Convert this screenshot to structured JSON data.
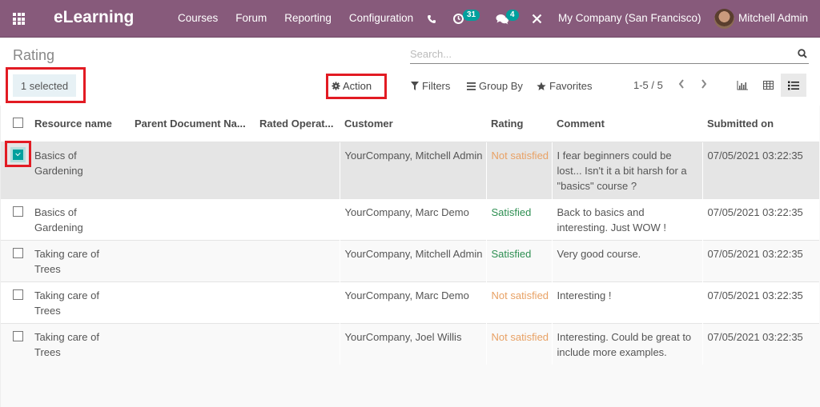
{
  "navbar": {
    "brand": "eLearning",
    "menu": [
      "Courses",
      "Forum",
      "Reporting",
      "Configuration"
    ],
    "activity_count": "31",
    "message_count": "4",
    "company": "My Company (San Francisco)",
    "user": "Mitchell Admin",
    "brand_color": "#875a7b",
    "badge_color": "#00a09d"
  },
  "control_panel": {
    "breadcrumb": "Rating",
    "search_placeholder": "Search...",
    "selected_label": "1 selected",
    "action_label": "Action",
    "filters_label": "Filters",
    "groupby_label": "Group By",
    "favorites_label": "Favorites",
    "pager": "1-5 / 5",
    "views": [
      "graph",
      "pivot",
      "list"
    ],
    "active_view": "list"
  },
  "table": {
    "columns": [
      "Resource name",
      "Parent Document Na...",
      "Rated Operat...",
      "Customer",
      "Rating",
      "Comment",
      "Submitted on"
    ],
    "rows": [
      {
        "selected": true,
        "resource": "Basics of Gardening",
        "parent": "",
        "operator": "",
        "customer": "YourCompany, Mitchell Admin",
        "rating": "Not satisfied",
        "rating_type": "not-sat",
        "comment": "I fear beginners could be lost... Isn't it a bit harsh for a \"basics\" course ?",
        "submitted": "07/05/2021 03:22:35"
      },
      {
        "selected": false,
        "resource": "Basics of Gardening",
        "parent": "",
        "operator": "",
        "customer": "YourCompany, Marc Demo",
        "rating": "Satisfied",
        "rating_type": "sat",
        "comment": "Back to basics and interesting. Just WOW !",
        "submitted": "07/05/2021 03:22:35"
      },
      {
        "selected": false,
        "resource": "Taking care of Trees",
        "parent": "",
        "operator": "",
        "customer": "YourCompany, Mitchell Admin",
        "rating": "Satisfied",
        "rating_type": "sat",
        "comment": "Very good course.",
        "submitted": "07/05/2021 03:22:35"
      },
      {
        "selected": false,
        "resource": "Taking care of Trees",
        "parent": "",
        "operator": "",
        "customer": "YourCompany, Marc Demo",
        "rating": "Not satisfied",
        "rating_type": "not-sat",
        "comment": "Interesting !",
        "submitted": "07/05/2021 03:22:35"
      },
      {
        "selected": false,
        "resource": "Taking care of Trees",
        "parent": "",
        "operator": "",
        "customer": "YourCompany, Joel Willis",
        "rating": "Not satisfied",
        "rating_type": "not-sat",
        "comment": "Interesting. Could be great to include more examples.",
        "submitted": "07/05/2021 03:22:35"
      }
    ]
  },
  "colors": {
    "not_satisfied": "#e8a164",
    "satisfied": "#2e8f52",
    "highlight_frame": "#e21b23"
  }
}
